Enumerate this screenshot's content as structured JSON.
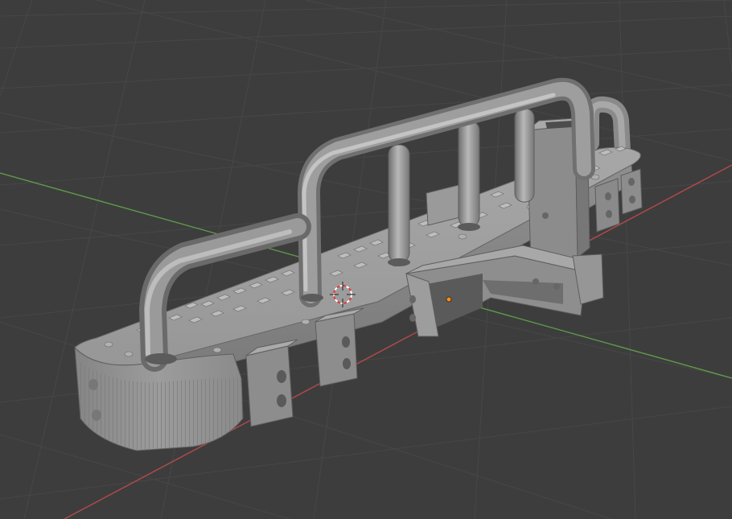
{
  "viewport": {
    "background_color": "#3d3d3d",
    "grid_color": "#474747",
    "x_axis_color": "#b34a4a",
    "y_axis_color": "#5f9a4b"
  },
  "model": {
    "name": "bumper-mesh",
    "body_color": "#8f8f8f",
    "shadow_color": "#6a6a6a",
    "highlight_color": "#b3b3b3"
  },
  "cursor": {
    "icon": "3d-cursor-icon"
  },
  "origin": {
    "icon": "object-origin-icon",
    "color": "#ff8c1a"
  }
}
